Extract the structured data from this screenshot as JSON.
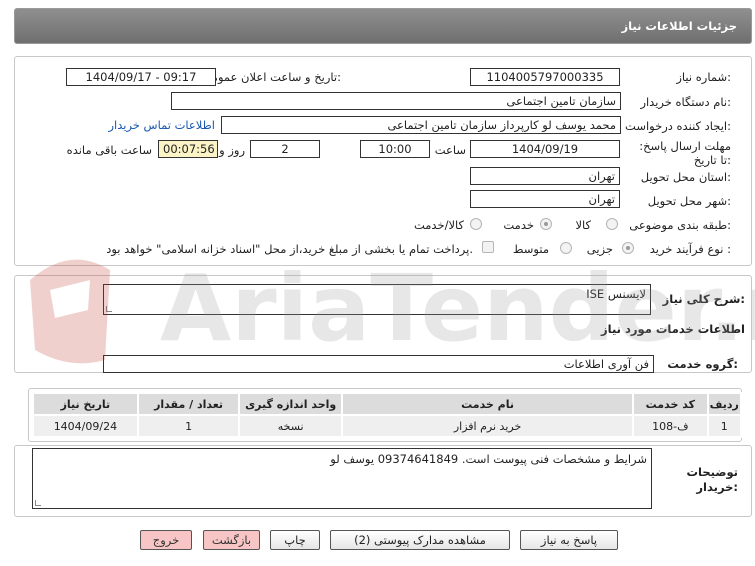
{
  "window": {
    "title": "جزئیات اطلاعات نیاز"
  },
  "form": {
    "need_number_label": "شماره نیاز:",
    "need_number": "1104005797000335",
    "announce_label": "تاریخ و ساعت اعلان عمومی:",
    "announce_value": "1404/09/17 - 09:17",
    "buyer_label": "نام دستگاه خریدار:",
    "buyer_value": "سازمان تامین اجتماعی",
    "creator_label": "ایجاد کننده درخواست:",
    "creator_value": "محمد یوسف لو کارپرداز سازمان تامین اجتماعی",
    "contact_link": "اطلاعات تماس خریدار",
    "deadline_label": "مهلت ارسال پاسخ: تا تاریخ:",
    "deadline_date": "1404/09/19",
    "time_label": "ساعت",
    "deadline_time": "10:00",
    "days_value": "2",
    "days_label": "روز و",
    "remaining_value": "00:07:56",
    "remaining_label": "ساعت باقی مانده",
    "province_label": "استان محل تحویل:",
    "province_value": "تهران",
    "city_label": "شهر محل تحویل:",
    "city_value": "تهران",
    "category_label": "طبقه بندی موضوعی:",
    "category_options": [
      "کالا",
      "خدمت",
      "کالا/خدمت"
    ],
    "category_selected": "خدمت",
    "process_label": "نوع فرآیند خرید :",
    "process_options": [
      "جزیی",
      "متوسط"
    ],
    "process_selected": "جزیی",
    "payment_note": "پرداخت تمام یا بخشی از مبلغ خرید،از محل \"اسناد خزانه اسلامی\" خواهد بود."
  },
  "description": {
    "label": "شرح کلی نیاز:",
    "value": "لایسنس ISE"
  },
  "services": {
    "section_title": "اطلاعات خدمات مورد نیاز",
    "group_label": "گروه خدمت:",
    "group_value": "فن آوری اطلاعات",
    "table": {
      "headers": [
        "ردیف",
        "کد خدمت",
        "نام خدمت",
        "واحد اندازه گیری",
        "تعداد / مقدار",
        "تاریخ نیاز"
      ],
      "rows": [
        [
          "1",
          "ف-108",
          "خرید نرم افزار",
          "نسخه",
          "1",
          "1404/09/24"
        ]
      ]
    }
  },
  "buyer_notes": {
    "label_line1": "توضیحات",
    "label_line2": "خریدار:",
    "value": "شرایط و مشخصات فنی پیوست است. 09374641849 یوسف لو"
  },
  "actions": {
    "reply": "پاسخ به نیاز",
    "view_docs": "مشاهده مدارک پیوستی (2)",
    "print": "چاپ",
    "back": "بازگشت",
    "exit": "خروج"
  },
  "watermark_text": "AriaTender.neT",
  "colors": {
    "accent": "#7f7f7f",
    "link": "#1a56b0",
    "highlight": "#fcf3c6",
    "danger_button": "#f7c5c5"
  }
}
